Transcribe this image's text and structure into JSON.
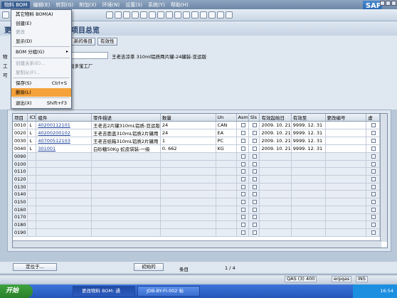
{
  "menubar": {
    "items": [
      "物料 BOM",
      "编辑(E)",
      "转到(G)",
      "附加(X)",
      "环境(N)",
      "设置(S)",
      "系统(Y)",
      "帮助(H)"
    ]
  },
  "title": {
    "left": "更",
    "right": "项目总览"
  },
  "buttons": {
    "new_item": "新的条目",
    "validity": "有效性"
  },
  "dropdown": {
    "items": [
      {
        "label": "其它物料 BOM(A)",
        "shortcut": "",
        "disabled": false
      },
      {
        "label": "创建(E)",
        "shortcut": "",
        "disabled": false
      },
      {
        "label": "更改",
        "shortcut": "",
        "disabled": true
      },
      {
        "label": "显示(D)",
        "shortcut": "",
        "disabled": false
      },
      {
        "label": "BOM 分组(G)",
        "shortcut": "▸",
        "disabled": false
      },
      {
        "label": "创建关系(E)...",
        "shortcut": "",
        "disabled": true
      },
      {
        "label": "复制从(F)...",
        "shortcut": "",
        "disabled": true
      },
      {
        "label": "保存(S)",
        "shortcut": "Ctrl+S",
        "disabled": false
      },
      {
        "label": "删除(L)",
        "shortcut": "",
        "disabled": false
      },
      {
        "label": "退出(X)",
        "shortcut": "Shift+F3",
        "disabled": false
      }
    ]
  },
  "header": {
    "material_label": "物",
    "material_value": "01",
    "material_desc": "王老吉凉茶 310ml铝质两片罐-24罐装-亚运版",
    "plant_label": "工",
    "plant_desc": "加多宝工厂",
    "alt_label": "可"
  },
  "grid": {
    "columns": [
      "项目",
      "ICt",
      "组件",
      "零件描述",
      "数量",
      "Un",
      "Asm",
      "Sls",
      "有效起始日",
      "有效至",
      "更改编号",
      "虚",
      ""
    ],
    "rows": [
      {
        "item": "0010",
        "ict": "L",
        "component": "40200112101",
        "desc": "王老吉2片罐310mL铝质-亚运版",
        "qty": "24",
        "un": "CAN",
        "from": "2009. 10. 21",
        "to": "9999. 12. 31"
      },
      {
        "item": "0020",
        "ict": "L",
        "component": "40200200102",
        "desc": "王老吉面盖310mL铝质2片罐用",
        "qty": "24",
        "un": "EA",
        "from": "2009. 10. 21",
        "to": "9999. 12. 31"
      },
      {
        "item": "0030",
        "ict": "L",
        "component": "40700512103",
        "desc": "王老吉纸箱310mL铝质2片罐用",
        "qty": "1",
        "un": "PC",
        "from": "2009. 10. 21",
        "to": "9999. 12. 31"
      },
      {
        "item": "0040",
        "ict": "L",
        "component": "301001",
        "desc": "白砂糖50Kg 蛇皮袋装-一级",
        "qty": "0. 662",
        "un": "KG",
        "from": "2009. 10. 21",
        "to": "9999. 12. 31"
      },
      {
        "item": "0090"
      },
      {
        "item": "0100"
      },
      {
        "item": "0110"
      },
      {
        "item": "0120"
      },
      {
        "item": "0130"
      },
      {
        "item": "0140"
      },
      {
        "item": "0150"
      },
      {
        "item": "0160"
      },
      {
        "item": "0170"
      },
      {
        "item": "0180"
      },
      {
        "item": "0190"
      }
    ]
  },
  "bottom": {
    "locate_button": "定位于...",
    "first_button": "初始的",
    "items_label": "条目",
    "page": "1 / 4"
  },
  "status": {
    "system": "QAS (3) 400",
    "server": "erpqas",
    "mode": "INS"
  },
  "taskbar": {
    "start": "开始",
    "tasks": [
      "更改物料 BOM: 通",
      "JDB-BY-FI-002 标"
    ],
    "time": "16:54"
  }
}
